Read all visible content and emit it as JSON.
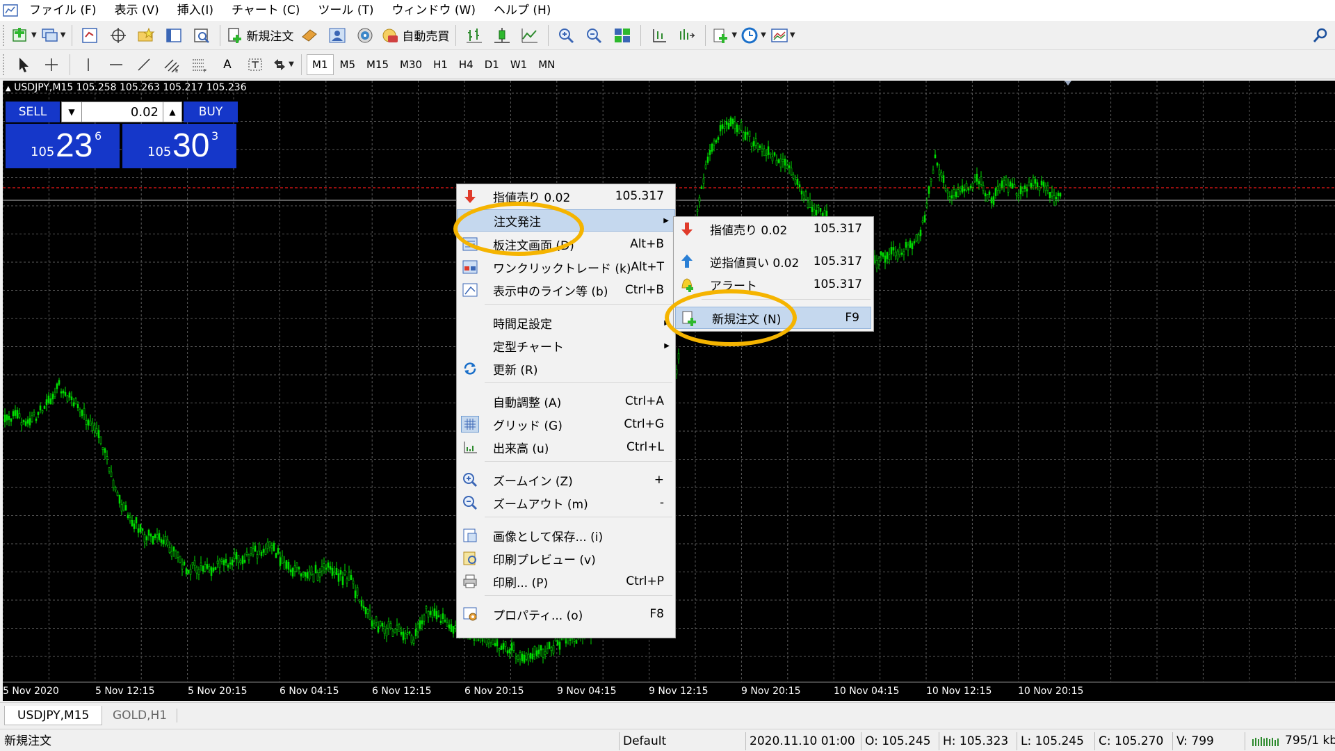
{
  "menubar": {
    "items": [
      "ファイル (F)",
      "表示 (V)",
      "挿入(I)",
      "チャート (C)",
      "ツール (T)",
      "ウィンドウ (W)",
      "ヘルプ (H)"
    ]
  },
  "toolbar": {
    "new_order_label": "新規注文",
    "auto_trading_label": "自動売買",
    "timeframes": [
      "M1",
      "M5",
      "M15",
      "M30",
      "H1",
      "H4",
      "D1",
      "W1",
      "MN"
    ],
    "active_timeframe": "M15"
  },
  "chart": {
    "header": "USDJPY,M15  105.258 105.263 105.217 105.236",
    "x_labels": [
      "5 Nov 2020",
      "5 Nov 12:15",
      "5 Nov 20:15",
      "6 Nov 04:15",
      "6 Nov 12:15",
      "6 Nov 20:15",
      "9 Nov 04:15",
      "9 Nov 12:15",
      "9 Nov 20:15",
      "10 Nov 04:15",
      "10 Nov 12:15",
      "10 Nov 20:15"
    ],
    "candle_color": "#00dd00",
    "background": "#000000",
    "grid_color": "#5a5a5a",
    "ask_line_color": "#c81414"
  },
  "one_click": {
    "sell_label": "SELL",
    "buy_label": "BUY",
    "lot": "0.02",
    "sell_price": {
      "prefix": "105",
      "big": "23",
      "sup": "6"
    },
    "buy_price": {
      "prefix": "105",
      "big": "30",
      "sup": "3"
    },
    "color": "#1537c9"
  },
  "context_menu": {
    "items": [
      {
        "label": "指値売り 0.02",
        "shortcut": "105.317",
        "icon": "sell-arrow-icon"
      },
      {
        "label": "注文発注",
        "shortcut": "",
        "submenu": true,
        "highlighted": true
      },
      {
        "label": "板注文画面 (D)",
        "shortcut": "Alt+B",
        "icon": "depth-of-market-icon"
      },
      {
        "label": "ワンクリックトレード (k)",
        "shortcut": "Alt+T",
        "icon": "one-click-trading-icon"
      },
      {
        "label": "表示中のライン等 (b)",
        "shortcut": "Ctrl+B",
        "icon": "objects-list-icon"
      },
      {
        "label": "時間足設定",
        "shortcut": "",
        "submenu": true
      },
      {
        "label": "定型チャート",
        "shortcut": "",
        "submenu": true
      },
      {
        "label": "更新 (R)",
        "shortcut": "",
        "icon": "refresh-icon"
      },
      {
        "label": "自動調整 (A)",
        "shortcut": "Ctrl+A"
      },
      {
        "label": "グリッド (G)",
        "shortcut": "Ctrl+G",
        "icon": "grid-icon"
      },
      {
        "label": "出来高 (u)",
        "shortcut": "Ctrl+L",
        "icon": "volume-icon"
      },
      {
        "label": "ズームイン (Z)",
        "shortcut": "+",
        "icon": "zoom-in-icon"
      },
      {
        "label": "ズームアウト (m)",
        "shortcut": "-",
        "icon": "zoom-out-icon"
      },
      {
        "label": "画像として保存... (i)",
        "shortcut": "",
        "icon": "save-image-icon"
      },
      {
        "label": "印刷プレビュー (v)",
        "shortcut": "",
        "icon": "print-preview-icon"
      },
      {
        "label": "印刷... (P)",
        "shortcut": "Ctrl+P",
        "icon": "print-icon"
      },
      {
        "label": "プロパティ... (o)",
        "shortcut": "F8",
        "icon": "properties-icon"
      }
    ]
  },
  "submenu": {
    "items": [
      {
        "label": "指値売り 0.02",
        "shortcut": "105.317",
        "icon": "sell-arrow-icon"
      },
      {
        "label": "逆指値買い 0.02",
        "shortcut": "105.317",
        "icon": "buy-arrow-icon"
      },
      {
        "label": "アラート",
        "shortcut": "105.317",
        "icon": "alert-bell-icon"
      },
      {
        "label": "新規注文 (N)",
        "shortcut": "F9",
        "icon": "new-order-icon",
        "highlighted": true
      }
    ]
  },
  "highlight_color": "#f5b400",
  "tabs": [
    "USDJPY,M15",
    "GOLD,H1"
  ],
  "status": {
    "hint": "新規注文",
    "profile": "Default",
    "datetime": "2020.11.10 01:00",
    "open": "O: 105.245",
    "high": "H: 105.323",
    "low": "L: 105.245",
    "close": "C: 105.270",
    "volume": "V: 799",
    "traffic": "795/1 kb"
  }
}
